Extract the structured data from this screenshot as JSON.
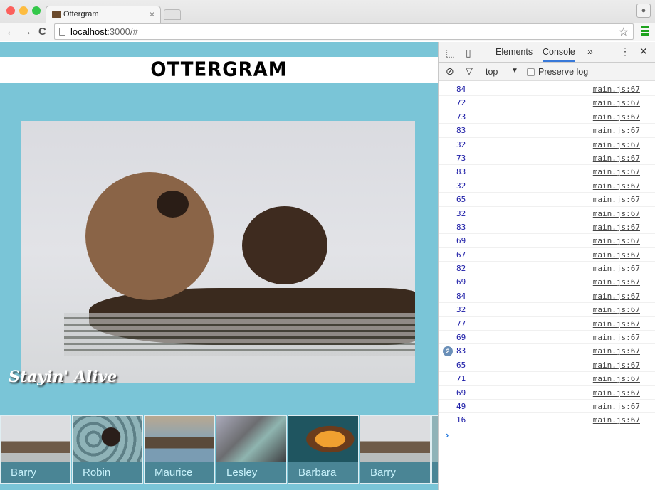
{
  "browser": {
    "tab_title": "Ottergram",
    "tab_close": "×",
    "url_host": "localhost",
    "url_rest": ":3000/#",
    "back": "←",
    "forward": "→",
    "reload": "C",
    "star": "☆",
    "profile": "👤"
  },
  "page": {
    "logo": "OTTERGRAM",
    "caption": "Stayin' Alive",
    "colors": {
      "background": "#7ac5d7",
      "thumb_caption_bg": "#4a8595",
      "thumb_text": "#c8f2fb"
    },
    "thumbnails": [
      {
        "name": "Barry"
      },
      {
        "name": "Robin"
      },
      {
        "name": "Maurice"
      },
      {
        "name": "Lesley"
      },
      {
        "name": "Barbara"
      },
      {
        "name": "Barry"
      }
    ]
  },
  "devtools": {
    "tabs": [
      "Elements",
      "Console"
    ],
    "active_tab": "Console",
    "more": "»",
    "kebab": "⋮",
    "close": "✕",
    "context": "top",
    "preserve_log": "Preserve log",
    "preserve_log_checked": false,
    "console_rows": [
      {
        "value": "84",
        "source": "main.js:67"
      },
      {
        "value": "72",
        "source": "main.js:67"
      },
      {
        "value": "73",
        "source": "main.js:67"
      },
      {
        "value": "83",
        "source": "main.js:67"
      },
      {
        "value": "32",
        "source": "main.js:67"
      },
      {
        "value": "73",
        "source": "main.js:67"
      },
      {
        "value": "83",
        "source": "main.js:67"
      },
      {
        "value": "32",
        "source": "main.js:67"
      },
      {
        "value": "65",
        "source": "main.js:67"
      },
      {
        "value": "32",
        "source": "main.js:67"
      },
      {
        "value": "83",
        "source": "main.js:67"
      },
      {
        "value": "69",
        "source": "main.js:67"
      },
      {
        "value": "67",
        "source": "main.js:67"
      },
      {
        "value": "82",
        "source": "main.js:67"
      },
      {
        "value": "69",
        "source": "main.js:67"
      },
      {
        "value": "84",
        "source": "main.js:67"
      },
      {
        "value": "32",
        "source": "main.js:67"
      },
      {
        "value": "77",
        "source": "main.js:67"
      },
      {
        "value": "69",
        "source": "main.js:67"
      },
      {
        "value": "83",
        "source": "main.js:67",
        "repeat": "2"
      },
      {
        "value": "65",
        "source": "main.js:67"
      },
      {
        "value": "71",
        "source": "main.js:67"
      },
      {
        "value": "69",
        "source": "main.js:67"
      },
      {
        "value": "49",
        "source": "main.js:67"
      },
      {
        "value": "16",
        "source": "main.js:67"
      }
    ],
    "prompt": "›"
  }
}
